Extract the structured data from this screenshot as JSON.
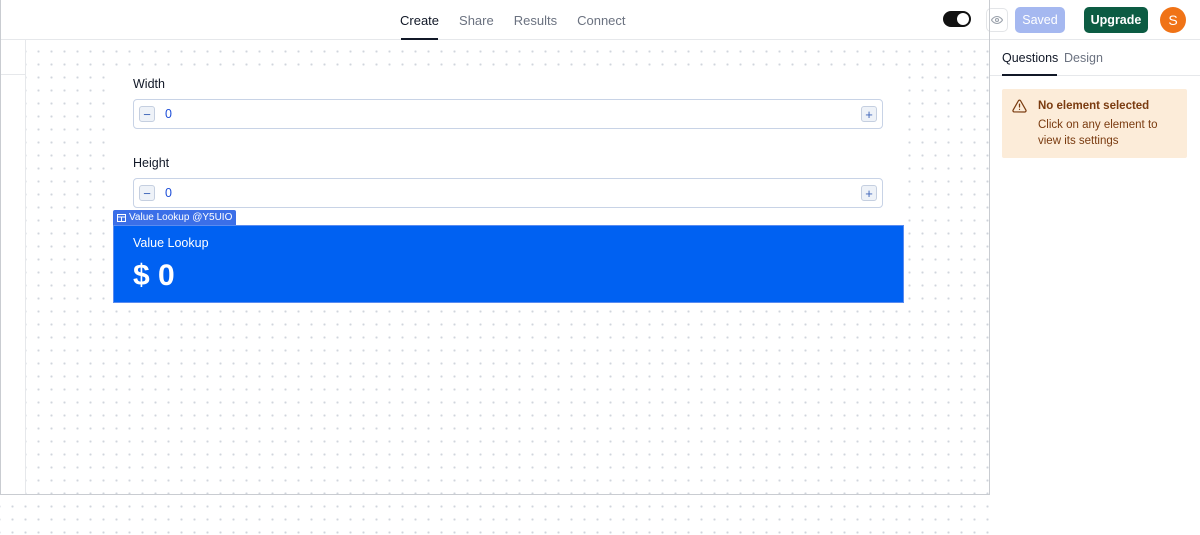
{
  "header": {
    "tabs": [
      {
        "label": "Create",
        "active": true
      },
      {
        "label": "Share",
        "active": false
      },
      {
        "label": "Results",
        "active": false
      },
      {
        "label": "Connect",
        "active": false
      }
    ],
    "toggle_on": true,
    "preview_icon": "eye-icon",
    "saved_label": "Saved",
    "upgrade_label": "Upgrade",
    "avatar_initial": "S"
  },
  "form": {
    "fields": [
      {
        "label": "Width",
        "value": "0"
      },
      {
        "label": "Height",
        "value": "0"
      }
    ],
    "minus_glyph": "−",
    "plus_glyph": "+"
  },
  "lookup": {
    "tag_label": "Value Lookup @Y5UIO",
    "tag_icon": "table-icon",
    "title": "Value Lookup",
    "value": "$ 0",
    "background_color": "#0061f2"
  },
  "panel": {
    "tabs": [
      {
        "label": "Questions",
        "active": true
      },
      {
        "label": "Design",
        "active": false
      }
    ],
    "notice": {
      "icon": "warning-icon",
      "title": "No element selected",
      "body": "Click on any element to view its settings",
      "background_color": "#fcecd9"
    }
  },
  "colors": {
    "upgrade": "#0c5c43",
    "saved": "#a5b8f0",
    "avatar": "#f07316"
  }
}
